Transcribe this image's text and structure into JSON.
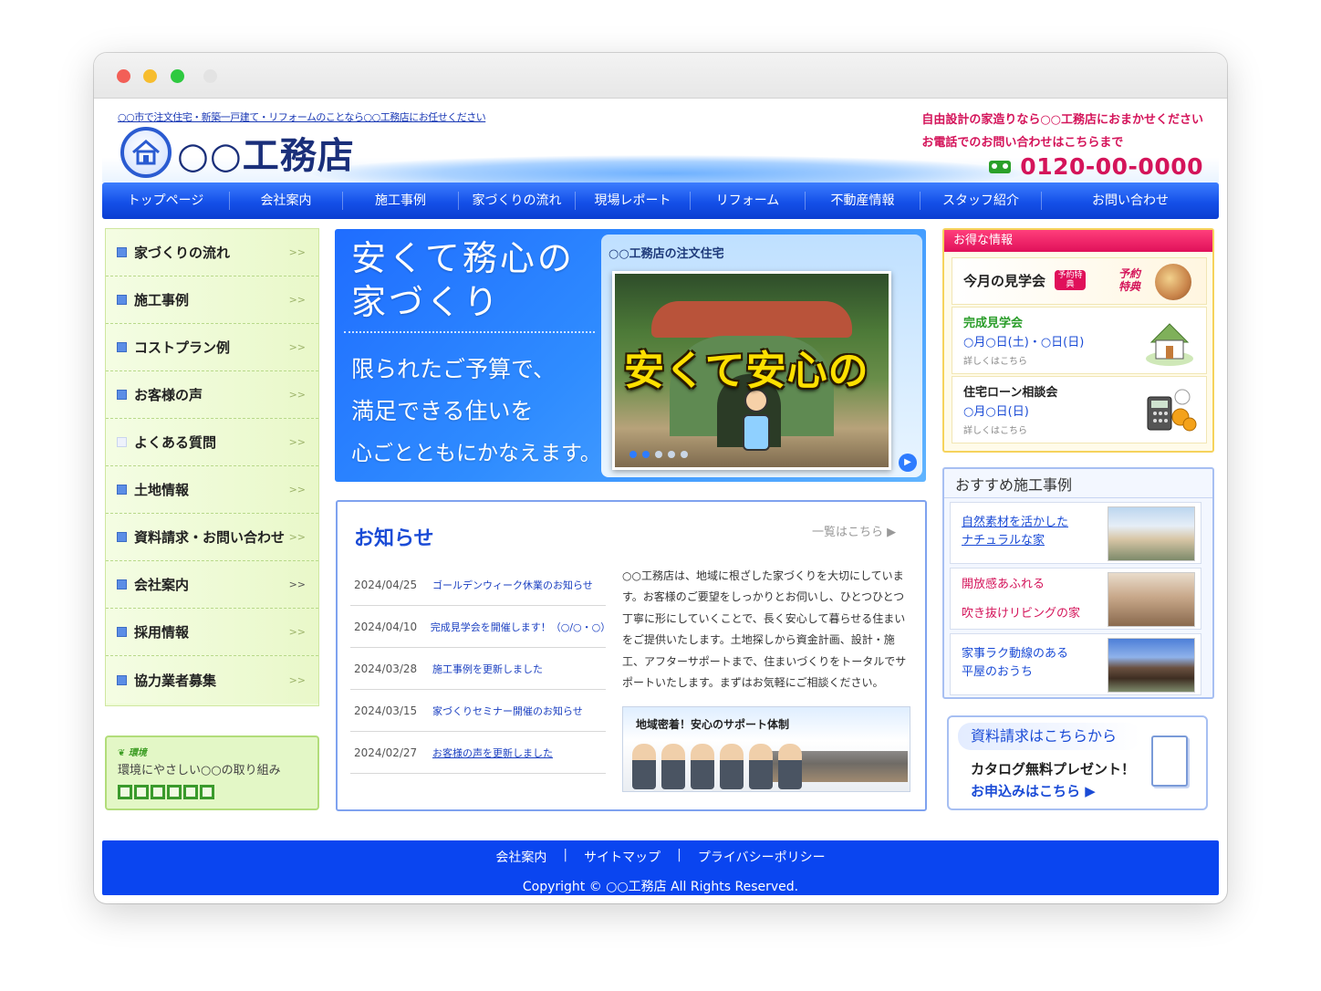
{
  "header": {
    "tagline": "○○市で注文住宅・新築一戸建て・リフォームのことなら○○工務店にお任せください",
    "logo_name": "○○工務店",
    "right_line1": "自由設計の家造りなら○○工務店におまかせください",
    "right_line2": "お電話でのお問い合わせはこちらまで",
    "phone": "0120-00-0000",
    "phone_icon": "free-dial-icon"
  },
  "nav": {
    "items": [
      "トップページ",
      "会社案内",
      "施工事例",
      "家づくりの流れ",
      "現場レポート",
      "リフォーム",
      "不動産情報",
      "スタッフ紹介",
      "お問い合わせ"
    ]
  },
  "sidebar": {
    "items": [
      "家づくりの流れ",
      "施工事例",
      "コストプラン例",
      "お客様の声",
      "よくある質問",
      "土地情報",
      "資料請求・お問い合わせ",
      "会社案内",
      "採用情報",
      "協力業者募集"
    ],
    "arrow": ">>",
    "eco_tag": "環境",
    "eco_text": "環境にやさしい○○の取り組み"
  },
  "hero": {
    "title_line1": "安くて務心の",
    "title_line2": "家づくり",
    "line1": "限られたご予算で、",
    "line2": "満足できる住いを",
    "line3": "心ごとともにかなえます。",
    "card_label": "○○工務店の注文住宅",
    "overlay": "安くて安心の"
  },
  "news": {
    "title": "お知らせ",
    "more": "一覧はこちら ▶",
    "items": [
      {
        "date": "2024/04/25",
        "text": "ゴールデンウィーク休業のお知らせ"
      },
      {
        "date": "2024/04/10",
        "text": "完成見学会を開催します！（○/○・○）"
      },
      {
        "date": "2024/03/28",
        "text": "施工事例を更新しました"
      },
      {
        "date": "2024/03/15",
        "text": "家づくりセミナー開催のお知らせ"
      },
      {
        "date": "2024/02/27",
        "text": "お客様の声を更新しました"
      }
    ],
    "body": "○○工務店は、地域に根ざした家づくりを大切にしています。お客様のご要望をしっかりとお伺いし、ひとつひとつ丁寧に形にしていくことで、長く安心して暮らせる住まいをご提供いたします。土地探しから資金計画、設計・施工、アフターサポートまで、住まいづくりをトータルでサポートいたします。まずはお気軽にご相談ください。",
    "support_title": "地域密着！安心のサポート体制"
  },
  "deals": {
    "head": "お得な情報",
    "open_house": "今月の見学会",
    "badge": "予約特典",
    "badge2_line1": "予約",
    "badge2_line2": "特典",
    "event1_title": "完成見学会",
    "event1_date": "○月○日(土)・○日(日)",
    "event1_sub": "詳しくはこちら",
    "event2_title": "住宅ローン相談会",
    "event2_date": "○月○日(日)",
    "event2_sub": "詳しくはこちら"
  },
  "works": {
    "head": "おすすめ施工事例",
    "items": [
      {
        "line1": "自然素材を活かした",
        "line2": "ナチュラルな家",
        "color": "#1a4bd6"
      },
      {
        "line1": "開放感あふれる",
        "line2": "吹き抜けリビングの家",
        "color": "#d4145a"
      },
      {
        "line1": "家事ラク動線のある",
        "line2": "平屋のおうち",
        "color": "#1a4bd6"
      }
    ]
  },
  "catalog": {
    "head": "資料請求はこちらから",
    "line1": "カタログ無料プレゼント！",
    "line2": "お申込みはこちら ▶"
  },
  "footer": {
    "links": [
      "会社案内",
      "サイトマップ",
      "プライバシーポリシー"
    ],
    "sep": "|",
    "copyright": "Copyright © ○○工務店 All Rights Reserved."
  },
  "colors": {
    "primary_blue": "#1450e8",
    "accent_pink": "#d4145a",
    "sidebar_green": "#eefbd6"
  }
}
